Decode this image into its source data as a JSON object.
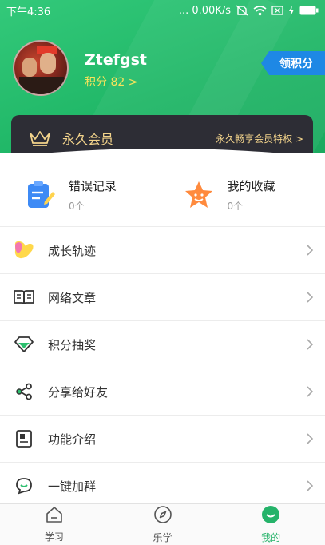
{
  "status_bar": {
    "time": "下午4:36",
    "network": "... 0.00K/s",
    "icons": [
      "no-sim-icon",
      "wifi-icon",
      "close-box-icon",
      "charging-icon",
      "battery-icon"
    ]
  },
  "profile": {
    "username": "Ztefgst",
    "points": "积分 82 >",
    "claim_button": "领积分"
  },
  "vip": {
    "title": "永久会员",
    "privilege_link": "永久畅享会员特权 >"
  },
  "quick_items": [
    {
      "title": "错误记录",
      "count": "0个",
      "icon": "clipboard-icon"
    },
    {
      "title": "我的收藏",
      "count": "0个",
      "icon": "star-icon"
    }
  ],
  "menu": [
    {
      "label": "成长轨迹",
      "icon": "growth-icon"
    },
    {
      "label": "网络文章",
      "icon": "book-icon"
    },
    {
      "label": "积分抽奖",
      "icon": "diamond-icon"
    },
    {
      "label": "分享给好友",
      "icon": "share-icon"
    },
    {
      "label": "功能介绍",
      "icon": "info-card-icon"
    },
    {
      "label": "一键加群",
      "icon": "chat-icon"
    }
  ],
  "bottom_nav": [
    {
      "label": "学习",
      "icon": "home-icon",
      "active": false
    },
    {
      "label": "乐学",
      "icon": "compass-icon",
      "active": false
    },
    {
      "label": "我的",
      "icon": "smile-icon",
      "active": true
    }
  ],
  "colors": {
    "primary_green": "#22b86a",
    "vip_bar": "#2d2d35",
    "vip_gold": "#f2d38b",
    "points_yellow": "#f6e35b",
    "claim_blue": "#1e88e5"
  }
}
